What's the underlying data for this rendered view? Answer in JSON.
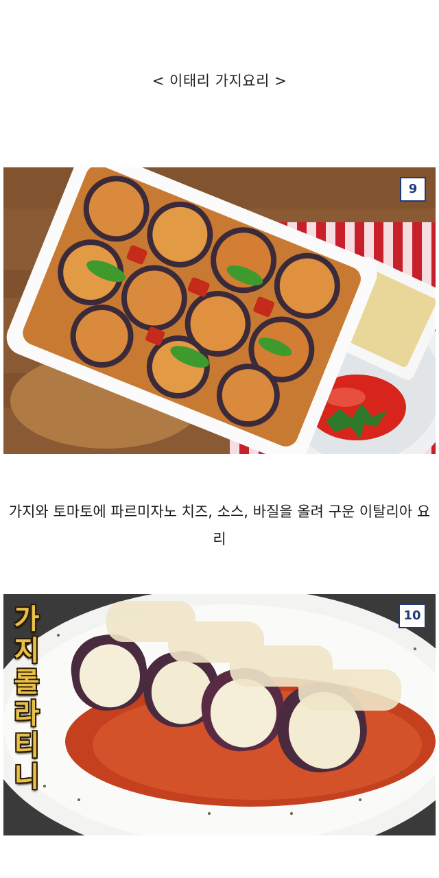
{
  "heading": "< 이태리 가지요리 >",
  "items": [
    {
      "number": "9",
      "caption": "가지와 토마토에 파르미자노 치즈, 소스, 바질을 올려 구운 이탈리아 요리"
    },
    {
      "number": "10",
      "title_chars": [
        "가",
        "지",
        "롤",
        "라",
        "티",
        "니"
      ]
    }
  ]
}
